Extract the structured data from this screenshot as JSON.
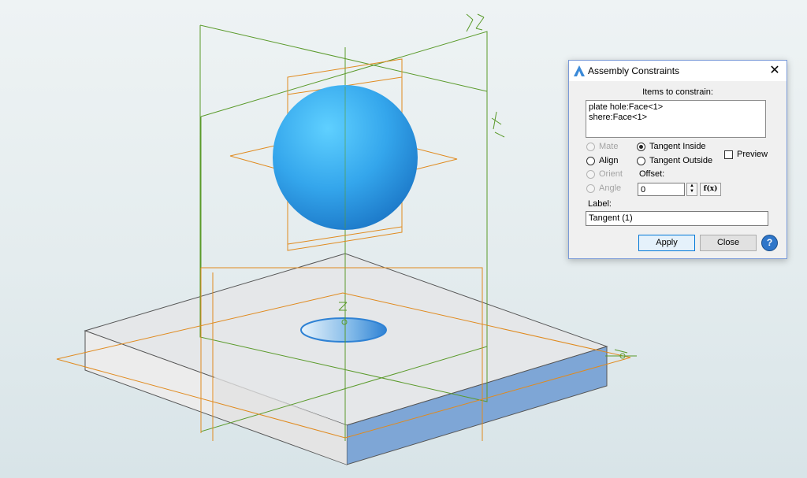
{
  "dialog": {
    "title": "Assembly Constraints",
    "items_label": "Items to constrain:",
    "items": [
      "plate hole:Face<1>",
      "shere:Face<1>"
    ],
    "options": {
      "mate": "Mate",
      "align": "Align",
      "orient": "Orient",
      "angle": "Angle",
      "tangent_inside": "Tangent Inside",
      "tangent_outside": "Tangent Outside",
      "selected": "tangent_inside"
    },
    "preview_label": "Preview",
    "offset_label": "Offset:",
    "offset_value": "0",
    "fx_label": "f(x)",
    "label_label": "Label:",
    "label_value": "Tangent (1)",
    "apply_label": "Apply",
    "close_label": "Close",
    "help_symbol": "?",
    "close_symbol": "✕"
  },
  "viewport": {
    "axis_labels": {
      "y": "Y",
      "x": "X",
      "z": "Z"
    },
    "colors": {
      "sphere": "#3aaef0",
      "plate_top": "#e6e8ea",
      "plate_front": "#ececec",
      "plate_right": "#7ea6d6",
      "plane_green": "#5a9a2a",
      "plane_orange": "#e08a1e"
    }
  }
}
